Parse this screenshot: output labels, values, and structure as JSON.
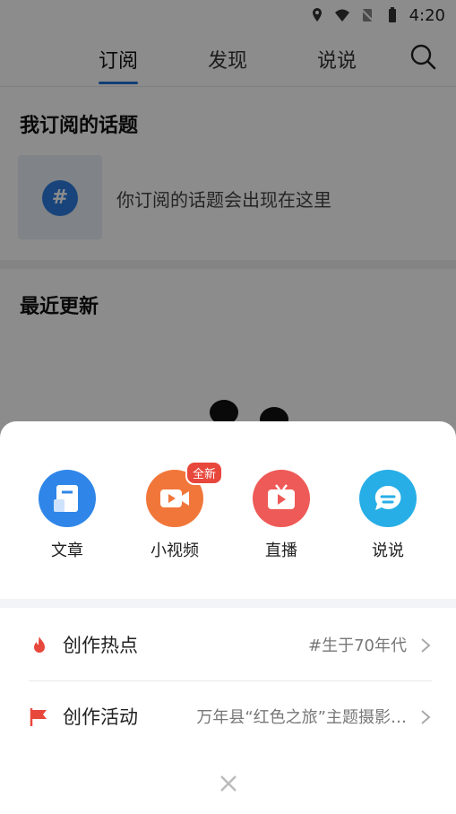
{
  "status": {
    "time": "4:20"
  },
  "tabs": [
    {
      "label": "订阅"
    },
    {
      "label": "发现"
    },
    {
      "label": "说说"
    }
  ],
  "subscribed": {
    "title": "我订阅的话题",
    "hint": "你订阅的话题会出现在这里"
  },
  "recent": {
    "title": "最近更新"
  },
  "sheet": {
    "create_items": [
      {
        "label": "文章",
        "icon": "article-icon",
        "color": "#2f86e8"
      },
      {
        "label": "小视频",
        "icon": "video-camera-icon",
        "color": "#f1763a",
        "badge": "全新"
      },
      {
        "label": "直播",
        "icon": "tv-icon",
        "color": "#ee5a57"
      },
      {
        "label": "说说",
        "icon": "chat-icon",
        "color": "#27aee6"
      }
    ],
    "rows": [
      {
        "title": "创作热点",
        "value": "#生于70年代",
        "icon": "fire-icon"
      },
      {
        "title": "创作活动",
        "value": "万年县“红色之旅”主题摄影…",
        "icon": "flag-icon"
      }
    ]
  },
  "colors": {
    "accent": "#1e73d8",
    "badge": "#e8473c",
    "fire": "#e8473c"
  }
}
